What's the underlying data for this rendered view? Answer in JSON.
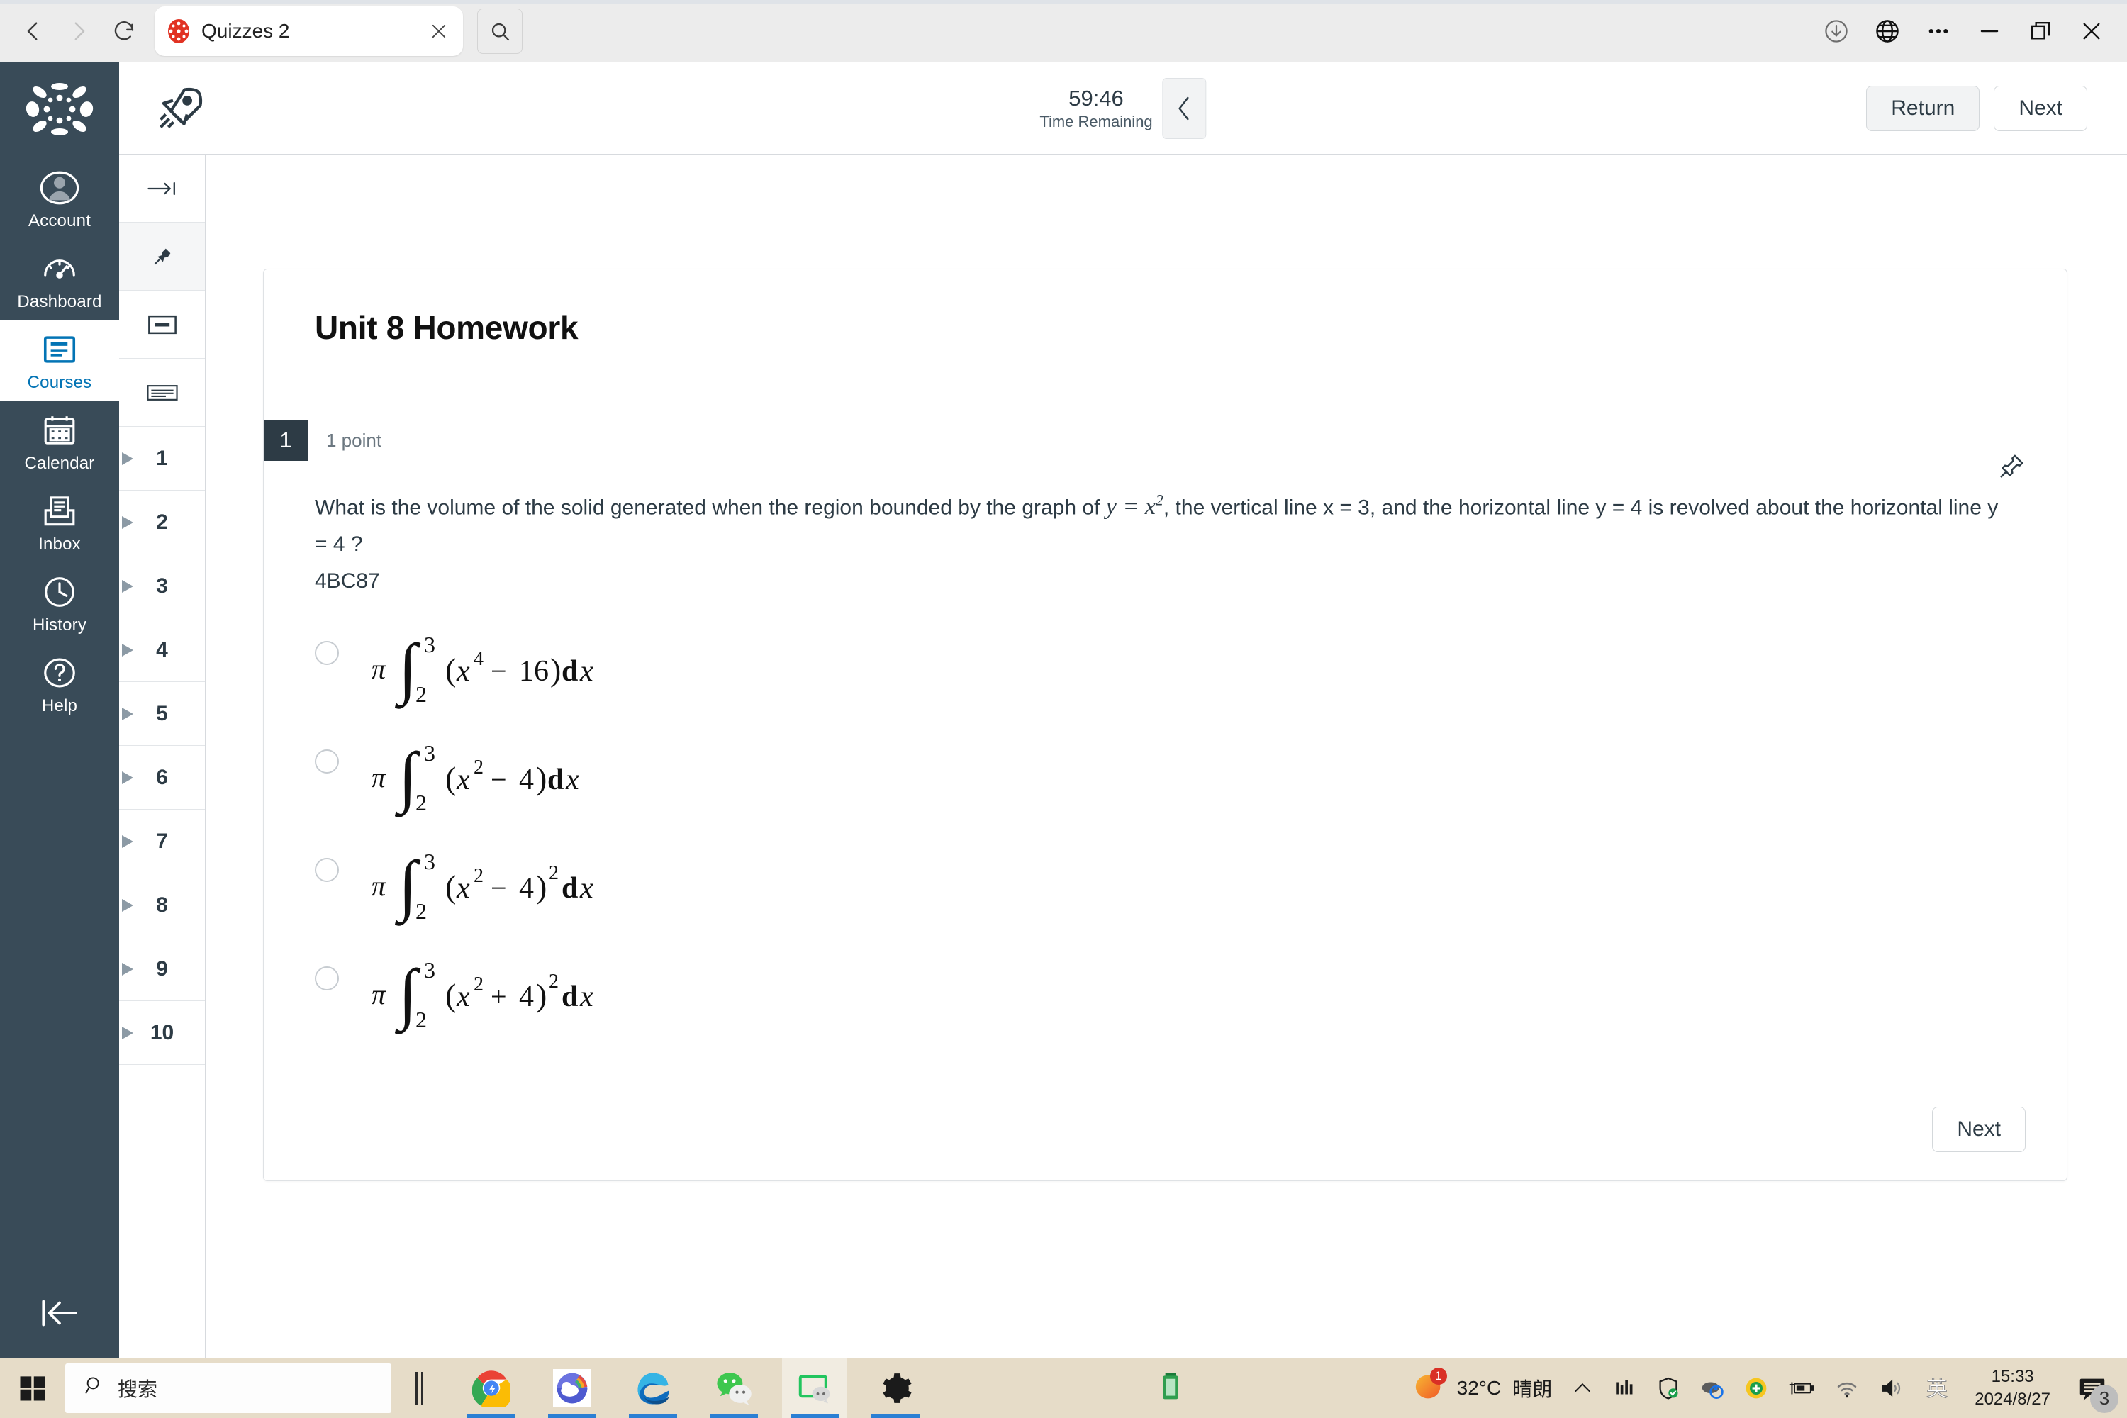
{
  "browser": {
    "back_icon": "back-arrow-icon",
    "forward_icon": "forward-arrow-icon",
    "refresh_icon": "refresh-icon",
    "tab": {
      "title": "Quizzes 2",
      "favicon": "canvas-logo-icon",
      "close_icon": "close-icon"
    },
    "tab_search_icon": "search-icon",
    "window_controls": {
      "download_icon": "download-icon",
      "globe_icon": "globe-icon",
      "more_icon": "more-options-icon",
      "minimize_icon": "minimize-icon",
      "restore_icon": "restore-icon",
      "close_icon": "close-icon"
    }
  },
  "canvas_nav": {
    "logo": "canvas-logo",
    "items": [
      {
        "label": "Account",
        "icon": "user-avatar-icon",
        "active": false
      },
      {
        "label": "Dashboard",
        "icon": "dashboard-gauge-icon",
        "active": false
      },
      {
        "label": "Courses",
        "icon": "courses-book-icon",
        "active": true
      },
      {
        "label": "Calendar",
        "icon": "calendar-icon",
        "active": false
      },
      {
        "label": "Inbox",
        "icon": "inbox-tray-icon",
        "active": false
      },
      {
        "label": "History",
        "icon": "clock-icon",
        "active": false
      },
      {
        "label": "Help",
        "icon": "question-mark-icon",
        "active": false
      }
    ],
    "collapse_icon": "collapse-left-icon"
  },
  "quiz_header": {
    "rocket_icon": "rocket-icon",
    "time_value": "59:46",
    "time_label": "Time Remaining",
    "collapse_icon": "chevron-left-icon",
    "return_label": "Return",
    "next_label": "Next"
  },
  "question_nav": {
    "tools": [
      {
        "icon": "jump-to-end-icon",
        "shaded": false
      },
      {
        "icon": "pin-icon",
        "shaded": true
      },
      {
        "icon": "single-question-view-icon",
        "shaded": false
      },
      {
        "icon": "list-view-icon",
        "shaded": false
      }
    ],
    "questions": [
      "1",
      "2",
      "3",
      "4",
      "5",
      "6",
      "7",
      "8",
      "9",
      "10"
    ]
  },
  "quiz": {
    "title": "Unit 8 Homework",
    "question_number": "1",
    "points": "1 point",
    "pin_icon": "pushpin-icon",
    "text_part1": "What is the volume of the solid generated when the region bounded by the graph of ",
    "formula_inline": "y = x²",
    "text_part2": ", the vertical line x = 3, and the horizontal line y = 4 is revolved about the horizontal line y = 4 ?",
    "code": "4BC87",
    "choices": [
      {
        "id": "a",
        "latex": "\\pi \\int_2^3 (x^4 - 16)\\,dx",
        "selected": false
      },
      {
        "id": "b",
        "latex": "\\pi \\int_2^3 (x^2 - 4)\\,dx",
        "selected": false
      },
      {
        "id": "c",
        "latex": "\\pi \\int_2^3 (x^2 - 4)^2\\,dx",
        "selected": false
      },
      {
        "id": "d",
        "latex": "\\pi \\int_2^3 (x^2 + 4)^2\\,dx",
        "selected": false
      }
    ],
    "next_label": "Next"
  },
  "taskbar": {
    "start_icon": "windows-start-icon",
    "search_placeholder": "搜索",
    "search_icon": "search-icon",
    "apps": [
      {
        "name": "chrome-icon",
        "open": true,
        "focused": false
      },
      {
        "name": "weather-app-icon",
        "open": true,
        "focused": false
      },
      {
        "name": "edge-icon",
        "open": true,
        "focused": false
      },
      {
        "name": "wechat-icon",
        "open": true,
        "focused": false
      },
      {
        "name": "screen-capture-icon",
        "open": true,
        "focused": true
      },
      {
        "name": "settings-gear-icon",
        "open": true,
        "focused": false
      }
    ],
    "middle_icon": "battery-green-icon",
    "weather_temp": "32°C",
    "weather_desc": "晴朗",
    "weather_badge": "1",
    "tray_icons": [
      "show-hidden-icons-chevron",
      "equalizer-icon",
      "security-shield-icon",
      "onedrive-sync-icon",
      "plus-circle-icon",
      "battery-charging-icon",
      "wifi-icon",
      "volume-icon",
      "ime-english-icon"
    ],
    "clock_time": "15:33",
    "clock_date": "2024/8/27",
    "notification_count": "3",
    "notification_icon": "notifications-icon"
  },
  "colors": {
    "canvas_nav_bg": "#394B58",
    "canvas_active": "#0374B5",
    "taskbar_bg": "#e6dcc8",
    "text_dark": "#2D3B45"
  }
}
